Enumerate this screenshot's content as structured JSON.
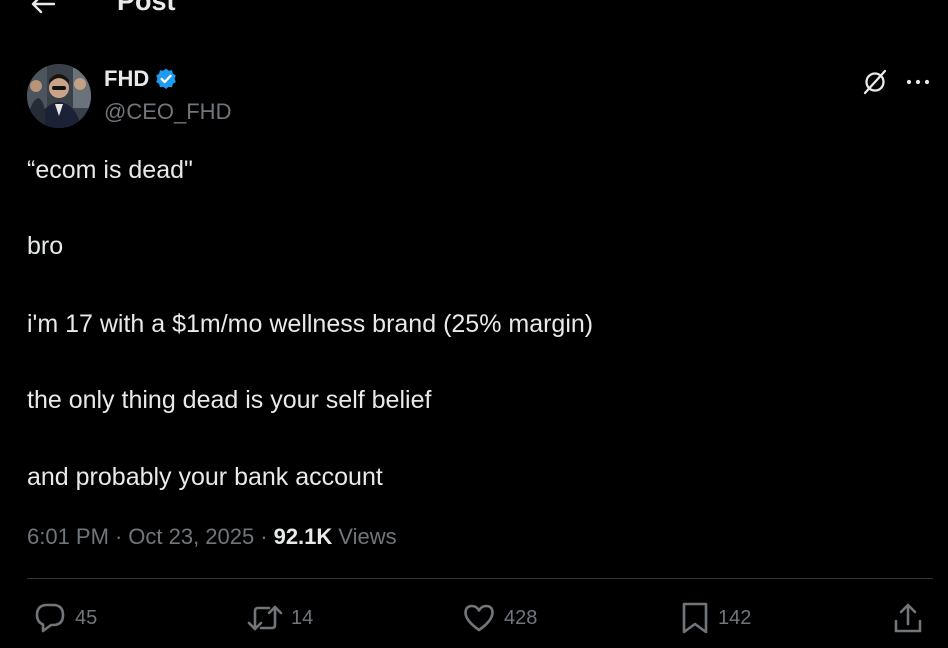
{
  "header": {
    "back_icon": "arrow-left-icon",
    "title": "Post"
  },
  "author": {
    "name": "FHD",
    "handle": "@CEO_FHD",
    "verified_icon": "verified-badge-icon",
    "verified_color": "#1d9bf0"
  },
  "top_actions": {
    "grok_icon": "grok-icon",
    "more_icon": "more-horizontal-icon"
  },
  "post": {
    "lines": [
      "“ecom is dead\"",
      "bro",
      "i'm 17 with a $1m/mo wellness brand (25% margin)",
      "the only thing dead is your self belief",
      "and probably your bank account"
    ]
  },
  "meta": {
    "time": "6:01 PM",
    "date": "Oct 23, 2025",
    "separator": "·",
    "views_count": "92.1K",
    "views_label": "Views"
  },
  "actions": {
    "replies": "45",
    "reposts": "14",
    "likes": "428",
    "bookmarks": "142"
  },
  "colors": {
    "background": "#000000",
    "text_primary": "#e7e9ea",
    "text_secondary": "#71767b",
    "divider": "#2f3336"
  }
}
